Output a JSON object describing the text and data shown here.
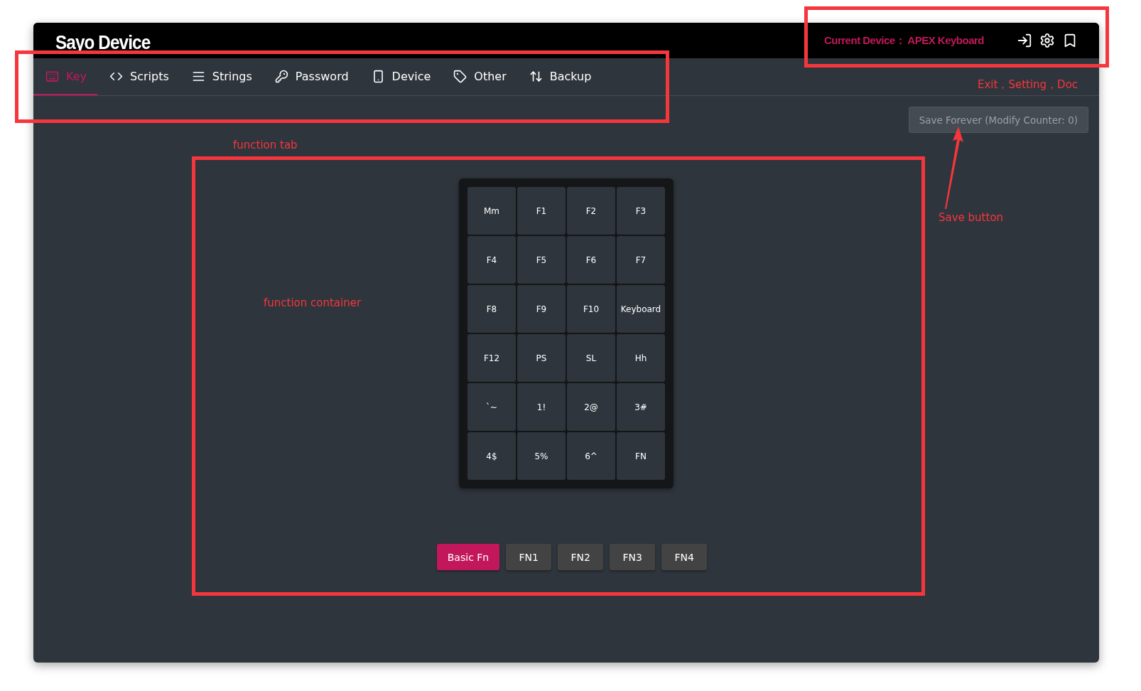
{
  "header": {
    "title": "Sayo Device",
    "device_label": "Current Device：",
    "device_name": "APEX Keyboard"
  },
  "tabs": [
    {
      "label": "Key",
      "selected": true
    },
    {
      "label": "Scripts",
      "selected": false
    },
    {
      "label": "Strings",
      "selected": false
    },
    {
      "label": "Password",
      "selected": false
    },
    {
      "label": "Device",
      "selected": false
    },
    {
      "label": "Other",
      "selected": false
    },
    {
      "label": "Backup",
      "selected": false
    }
  ],
  "save_button": {
    "label": "Save Forever (Modify Counter: 0)",
    "disabled": true
  },
  "keys": [
    "Mm",
    "F1",
    "F2",
    "F3",
    "F4",
    "F5",
    "F6",
    "F7",
    "F8",
    "F9",
    "F10",
    "Keyboard",
    "F12",
    "PS",
    "SL",
    "Hh",
    "`~",
    "1!",
    "2@",
    "3#",
    "4$",
    "5%",
    "6^",
    "FN"
  ],
  "layers": [
    {
      "label": "Basic Fn",
      "selected": true
    },
    {
      "label": "FN1",
      "selected": false
    },
    {
      "label": "FN2",
      "selected": false
    },
    {
      "label": "FN3",
      "selected": false
    },
    {
      "label": "FN4",
      "selected": false
    }
  ],
  "annotations": {
    "header_note": "Exit，Setting，Doc",
    "tab_note": "function tab",
    "container_note": "function container",
    "save_note": "Save button"
  }
}
